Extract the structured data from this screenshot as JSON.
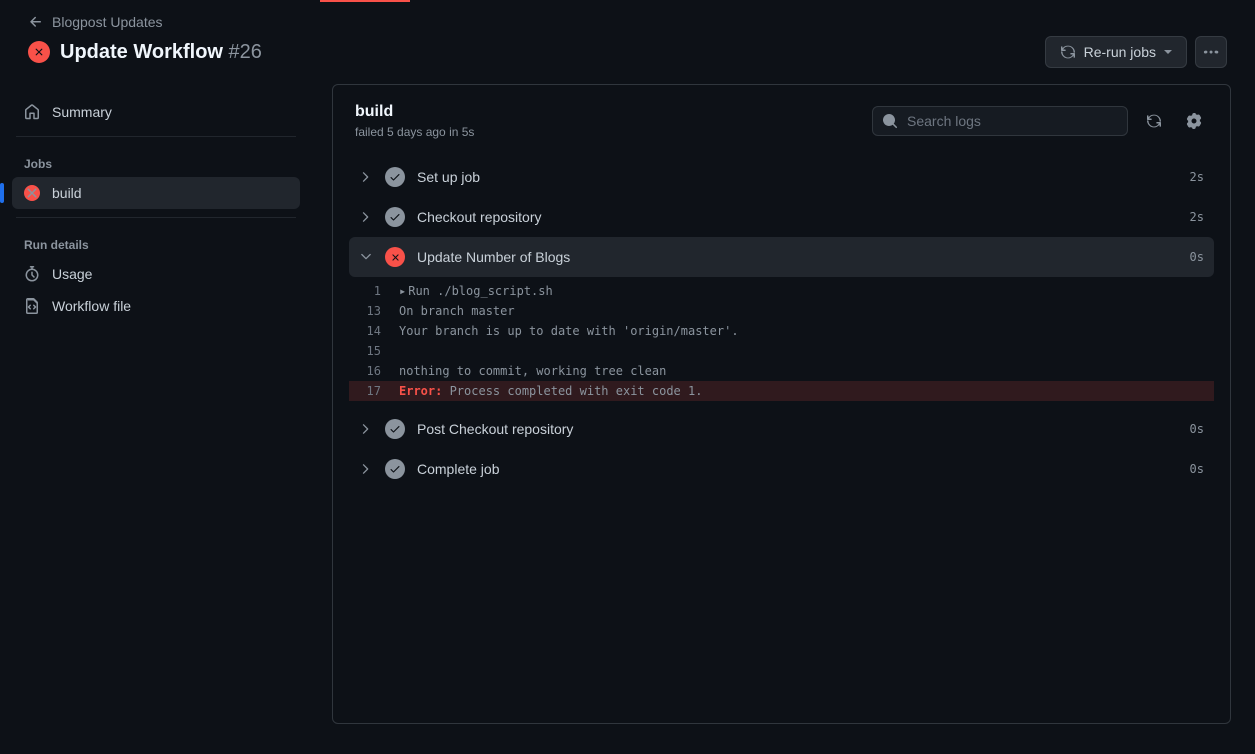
{
  "breadcrumb": {
    "back_label": "Blogpost Updates"
  },
  "title": {
    "workflow_name": "Update Workflow",
    "run_number": "#26"
  },
  "actions": {
    "rerun_label": "Re-run jobs"
  },
  "sidebar": {
    "summary_label": "Summary",
    "jobs_heading": "Jobs",
    "job_name": "build",
    "details_heading": "Run details",
    "usage_label": "Usage",
    "workflow_file_label": "Workflow file"
  },
  "job": {
    "name": "build",
    "status_line": "failed 5 days ago in 5s",
    "search_placeholder": "Search logs"
  },
  "steps": [
    {
      "name": "Set up job",
      "duration": "2s",
      "status": "ok",
      "expanded": false
    },
    {
      "name": "Checkout repository",
      "duration": "2s",
      "status": "ok",
      "expanded": false
    },
    {
      "name": "Update Number of Blogs",
      "duration": "0s",
      "status": "fail",
      "expanded": true
    },
    {
      "name": "Post Checkout repository",
      "duration": "0s",
      "status": "ok",
      "expanded": false
    },
    {
      "name": "Complete job",
      "duration": "0s",
      "status": "ok",
      "expanded": false
    }
  ],
  "log": [
    {
      "n": "1",
      "text": "Run ./blog_script.sh",
      "expandable": true
    },
    {
      "n": "13",
      "text": "On branch master"
    },
    {
      "n": "14",
      "text": "Your branch is up to date with 'origin/master'."
    },
    {
      "n": "15",
      "text": ""
    },
    {
      "n": "16",
      "text": "nothing to commit, working tree clean"
    },
    {
      "n": "17",
      "text": "Process completed with exit code 1.",
      "error_prefix": "Error:",
      "error": true
    }
  ]
}
